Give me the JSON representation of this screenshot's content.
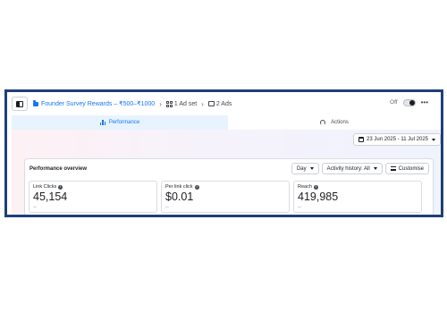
{
  "breadcrumb": {
    "campaign": "Founder Survey Rewards – ₹500–₹1000",
    "ad_set": "1 Ad set",
    "ads": "2 Ads"
  },
  "status_toggle": {
    "label": "Off",
    "state": "off"
  },
  "tabs": [
    {
      "label": "Performance",
      "active": true,
      "icon": "bar-chart-icon"
    },
    {
      "label": "Actions",
      "active": false,
      "icon": "gauge-icon"
    }
  ],
  "date_range": "23 Jun 2025 - 11 Jul 2025",
  "performance": {
    "title": "Performance overview",
    "controls": {
      "granularity": "Day",
      "activity_history": "Activity history: All",
      "customise": "Customise"
    },
    "metrics": [
      {
        "label": "Link Clicks",
        "value": "45,154",
        "sub": "--"
      },
      {
        "label": "Per link click",
        "value": "$0.01",
        "sub": "--"
      },
      {
        "label": "Reach",
        "value": "419,985",
        "sub": "--"
      }
    ]
  },
  "colors": {
    "accent": "#1877f2",
    "frame_border": "#1e3f7a",
    "active_tab_bg": "#e7f3ff"
  }
}
